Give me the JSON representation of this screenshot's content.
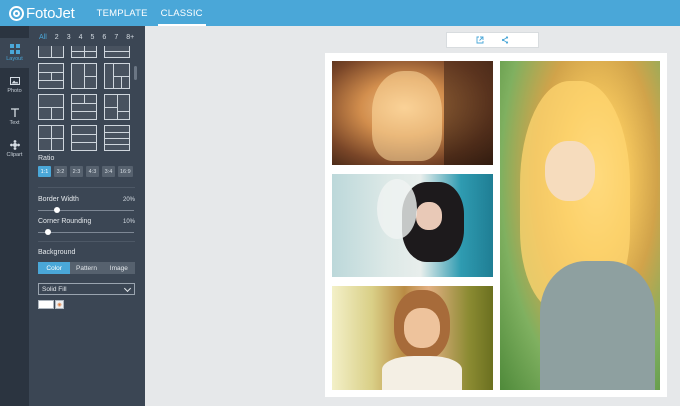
{
  "app": {
    "logo_text": "FotoJet"
  },
  "nav": {
    "tabs": [
      {
        "label": "TEMPLATE"
      },
      {
        "label": "CLASSIC"
      }
    ]
  },
  "rail": {
    "items": [
      {
        "label": "Layout",
        "icon": "layout-icon"
      },
      {
        "label": "Photo",
        "icon": "photo-icon"
      },
      {
        "label": "Text",
        "icon": "text-icon"
      },
      {
        "label": "Clipart",
        "icon": "clipart-icon"
      }
    ]
  },
  "panel": {
    "counts": [
      "All",
      "2",
      "3",
      "4",
      "5",
      "6",
      "7",
      "8+"
    ],
    "ratio_label": "Ratio",
    "ratios": [
      "1:1",
      "3:2",
      "2:3",
      "4:3",
      "3:4",
      "16:9"
    ],
    "border_width": {
      "label": "Border Width",
      "value": "20%",
      "level": 0.2
    },
    "corner_rounding": {
      "label": "Corner Rounding",
      "value": "10%",
      "level": 0.1
    },
    "background": {
      "label": "Background",
      "tabs": [
        "Color",
        "Pattern",
        "Image"
      ],
      "fill_select": "Solid Fill",
      "swatch_color": "#ffffff"
    }
  },
  "colors": {
    "accent": "#4aa7d8",
    "rail": "#2b3440",
    "panel": "#3b4654"
  }
}
